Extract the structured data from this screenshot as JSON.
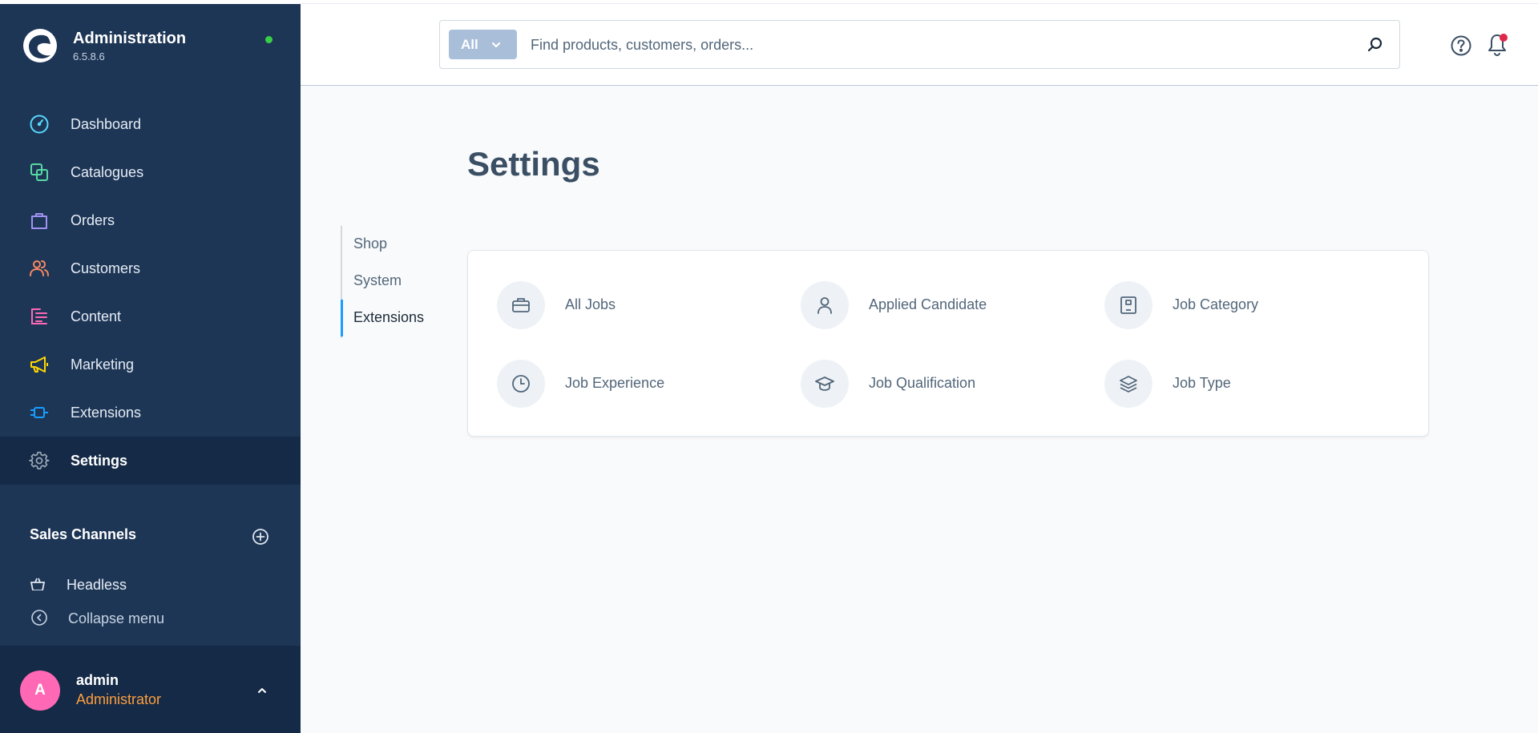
{
  "brand": {
    "title": "Administration",
    "version": "6.5.8.6",
    "status_color": "#37d046"
  },
  "sidebar": {
    "items": [
      {
        "label": "Dashboard",
        "icon": "dashboard-icon",
        "color": "#57d9ff"
      },
      {
        "label": "Catalogues",
        "icon": "catalogue-icon",
        "color": "#57d9a3"
      },
      {
        "label": "Orders",
        "icon": "orders-bag-icon",
        "color": "#a092f0"
      },
      {
        "label": "Customers",
        "icon": "customers-icon",
        "color": "#f88962"
      },
      {
        "label": "Content",
        "icon": "content-icon",
        "color": "#ff68b4"
      },
      {
        "label": "Marketing",
        "icon": "megaphone-icon",
        "color": "#ffd700"
      },
      {
        "label": "Extensions",
        "icon": "plug-icon",
        "color": "#189eff"
      },
      {
        "label": "Settings",
        "icon": "gear-icon",
        "color": "#9aa8b5"
      }
    ],
    "sales_channels_title": "Sales Channels",
    "headless_label": "Headless",
    "collapse_label": "Collapse menu"
  },
  "user": {
    "initial": "A",
    "name": "admin",
    "role": "Administrator"
  },
  "search": {
    "type_label": "All",
    "placeholder": "Find products, customers, orders..."
  },
  "page": {
    "title": "Settings"
  },
  "sub_nav": [
    {
      "label": "Shop"
    },
    {
      "label": "System"
    },
    {
      "label": "Extensions"
    }
  ],
  "extensions": [
    {
      "label": "All Jobs",
      "icon": "briefcase-icon"
    },
    {
      "label": "Applied Candidate",
      "icon": "person-icon"
    },
    {
      "label": "Job Category",
      "icon": "category-icon"
    },
    {
      "label": "Job Experience",
      "icon": "clock-icon"
    },
    {
      "label": "Job Qualification",
      "icon": "graduation-cap-icon"
    },
    {
      "label": "Job Type",
      "icon": "layers-icon"
    }
  ]
}
